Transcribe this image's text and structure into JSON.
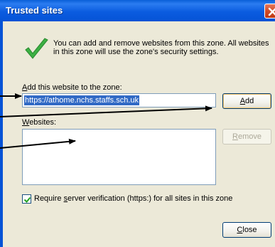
{
  "window": {
    "title": "Trusted sites",
    "close_icon": "close-icon"
  },
  "message": {
    "icon": "checkmark-icon",
    "text": "You can add and remove websites from this zone. All websites in this zone will use the zone's security settings."
  },
  "add_website": {
    "label_pre": "A",
    "label_rest": "dd this website to the zone:",
    "value": "https://athome.nchs.staffs.sch.uk",
    "add_button_pre": "A",
    "add_button_rest": "dd"
  },
  "websites": {
    "label_pre": "W",
    "label_rest": "ebsites:",
    "items": [],
    "remove_button_pre": "R",
    "remove_button_rest": "emove"
  },
  "verification": {
    "checked": true,
    "label_pre": "Require ",
    "label_u": "s",
    "label_rest": "erver verification (https:) for all sites in this zone"
  },
  "footer": {
    "close_button_pre": "C",
    "close_button_rest": "lose"
  },
  "colors": {
    "titlebar": "#0553d6",
    "dialog_bg": "#ece9d8",
    "selection": "#316ac5",
    "check_green": "#3cb043"
  }
}
